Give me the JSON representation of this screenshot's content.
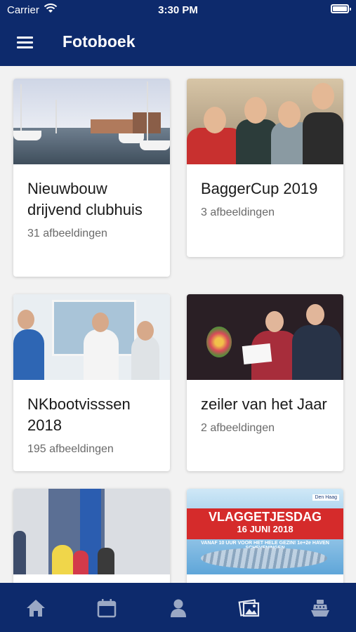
{
  "status_bar": {
    "carrier": "Carrier",
    "time": "3:30 PM"
  },
  "header": {
    "title": "Fotoboek",
    "menu_icon": "hamburger-menu-icon"
  },
  "colors": {
    "primary": "#0d2a6c",
    "background": "#f2f2f2",
    "card": "#ffffff",
    "tab_icon": "#9aa8c4"
  },
  "albums": [
    {
      "title": "Nieuwbouw drijvend clubhuis",
      "count": "31 afbeeldingen"
    },
    {
      "title": "BaggerCup 2019",
      "count": "3 afbeeldingen"
    },
    {
      "title": "NKbootvisssen 2018",
      "count": "195 afbeeldingen"
    },
    {
      "title": "zeiler van het Jaar",
      "count": "2 afbeeldingen"
    },
    {
      "title": "",
      "count": ""
    },
    {
      "title": "",
      "count": ""
    }
  ],
  "poster": {
    "headline": "VLAGGETJESDAG",
    "date": "16 JUNI 2018",
    "subline": "VANAF 10 UUR VOOR HET HELE GEZIN! 1e+2e HAVEN SCHEVENINGEN",
    "logo_text": "Den Haag"
  },
  "tabbar": {
    "items": [
      {
        "icon": "home-icon"
      },
      {
        "icon": "calendar-icon"
      },
      {
        "icon": "person-icon"
      },
      {
        "icon": "photos-icon"
      },
      {
        "icon": "boat-icon"
      }
    ]
  }
}
